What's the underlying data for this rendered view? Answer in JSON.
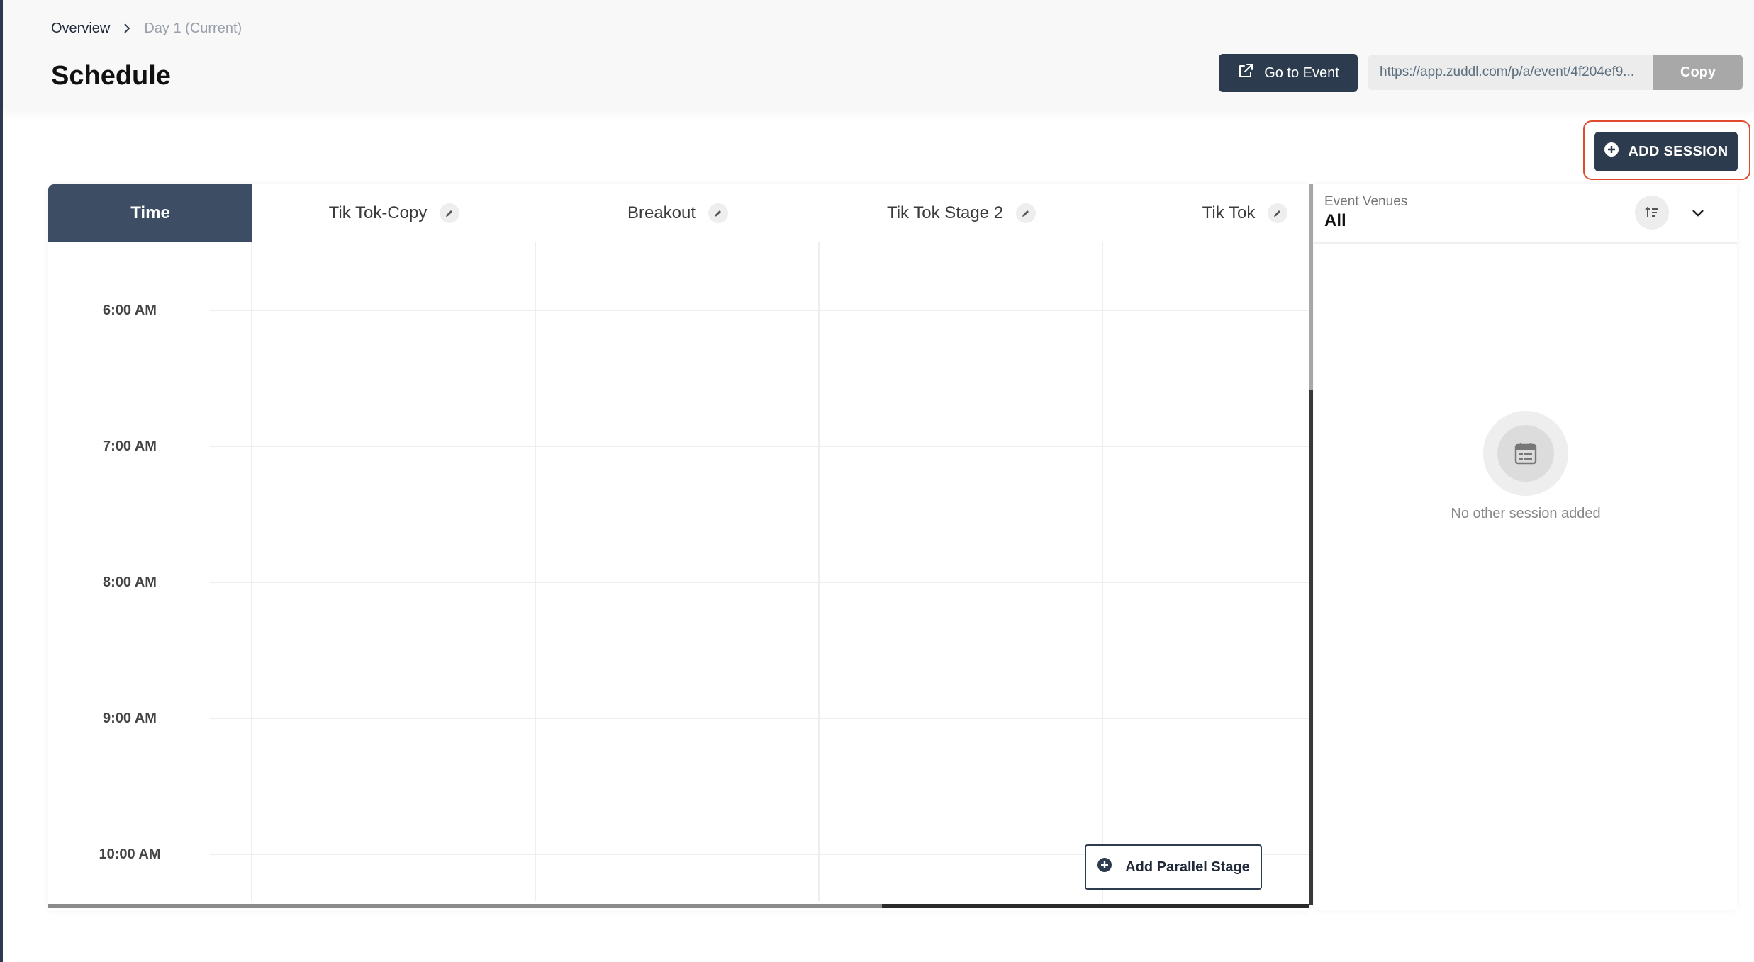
{
  "breadcrumb": {
    "overview": "Overview",
    "current": "Day 1 (Current)"
  },
  "page": {
    "title": "Schedule"
  },
  "actions": {
    "go_to_event": "Go to Event",
    "event_url": "https://app.zuddl.com/p/a/event/4f204ef9...",
    "copy": "Copy",
    "add_session": "ADD SESSION",
    "add_parallel_stage": "Add Parallel Stage"
  },
  "calendar": {
    "time_header": "Time",
    "stages": [
      "Tik Tok-Copy",
      "Breakout",
      "Tik Tok Stage 2",
      "Tik Tok"
    ],
    "time_slots": [
      "6:00 AM",
      "7:00 AM",
      "8:00 AM",
      "9:00 AM",
      "10:00 AM"
    ]
  },
  "venues": {
    "label": "Event Venues",
    "selected": "All",
    "empty_message": "No other session added"
  },
  "icons": {
    "external_link": "external-link-icon",
    "plus": "plus-circle-icon",
    "edit": "pencil-icon",
    "sort": "sort-icon",
    "chevron": "chevron-down-icon",
    "calendar": "calendar-icon"
  },
  "colors": {
    "primary": "#2d3b4f",
    "time_header": "#3d4d63",
    "highlight": "#e24a2d"
  }
}
